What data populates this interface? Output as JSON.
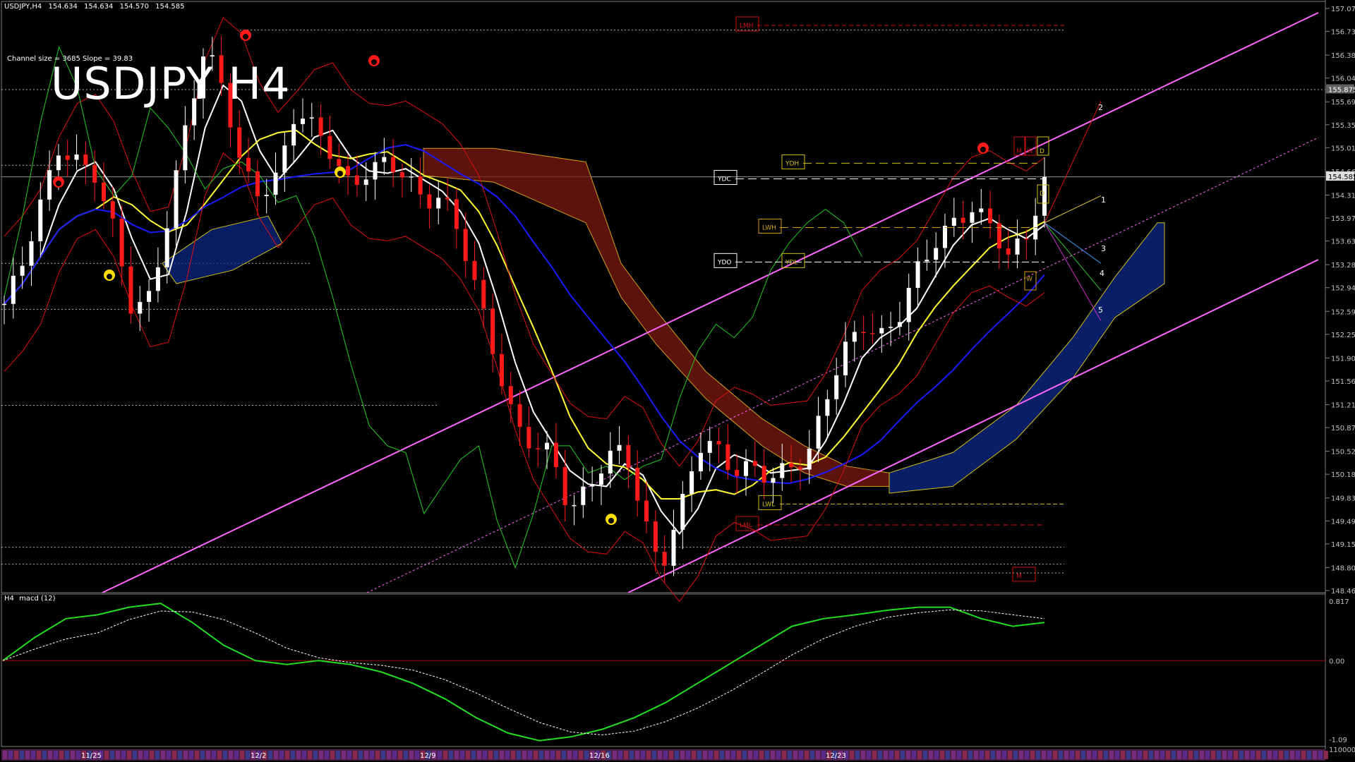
{
  "header": {
    "symbol_tf": "USDJPY,H4",
    "open": "154.634",
    "high": "154.634",
    "low": "154.570",
    "close": "154.585"
  },
  "channel_info": "Channel size = 3685 Slope = 39.83",
  "big_title": "USDJPY H4",
  "macd_panel": {
    "label": "H4",
    "name": "macd (12)"
  },
  "price_axis": [
    "157.070",
    "156.730",
    "156.380",
    "156.040",
    "155.690",
    "155.350",
    "155.010",
    "154.660",
    "154.310",
    "153.970",
    "153.630",
    "153.280",
    "152.940",
    "152.590",
    "152.250",
    "151.900",
    "151.560",
    "151.210",
    "150.870",
    "150.520",
    "150.180",
    "149.830",
    "149.490",
    "149.150",
    "148.800",
    "148.460"
  ],
  "price_tags": {
    "level": "155.875",
    "last": "154.585"
  },
  "macd_axis": [
    "0.817",
    "0.00",
    "-1.09",
    "110000"
  ],
  "date_labels": [
    "11/25",
    "12/2",
    "12/9",
    "12/16",
    "12/23"
  ],
  "level_boxes": [
    "LMH",
    "YDH",
    "YDC",
    "LWH",
    "YDO",
    "YDL",
    "LWL",
    "LML",
    "M",
    "M",
    "W",
    "D",
    "D",
    "W"
  ],
  "wave_labels": [
    "2",
    "1",
    "3",
    "4",
    "5"
  ],
  "chart_data": {
    "type": "line",
    "title": "USDJPY H4",
    "y_range": [
      148.46,
      157.07
    ],
    "series": [
      {
        "values": [
          152.7,
          153.3,
          154.2,
          155.0,
          154.8,
          154.6,
          153.8,
          152.6,
          152.8,
          154.0,
          155.4,
          156.5,
          155.9,
          154.7,
          154.3,
          154.6,
          155.6,
          155.3,
          154.9,
          154.4,
          154.7,
          154.8,
          154.6,
          154.2,
          154.3,
          153.7,
          152.8,
          151.8,
          150.9,
          150.6,
          150.5,
          149.6,
          150.0,
          150.4,
          150.6,
          149.5,
          148.8,
          149.6,
          150.6,
          150.6,
          150.2,
          150.3,
          150.1,
          150.3,
          150.4,
          151.3,
          152.0,
          152.4,
          152.2,
          152.5,
          153.2,
          153.6,
          153.9,
          154.1,
          153.9,
          153.4,
          153.7,
          154.5
        ]
      }
    ]
  }
}
